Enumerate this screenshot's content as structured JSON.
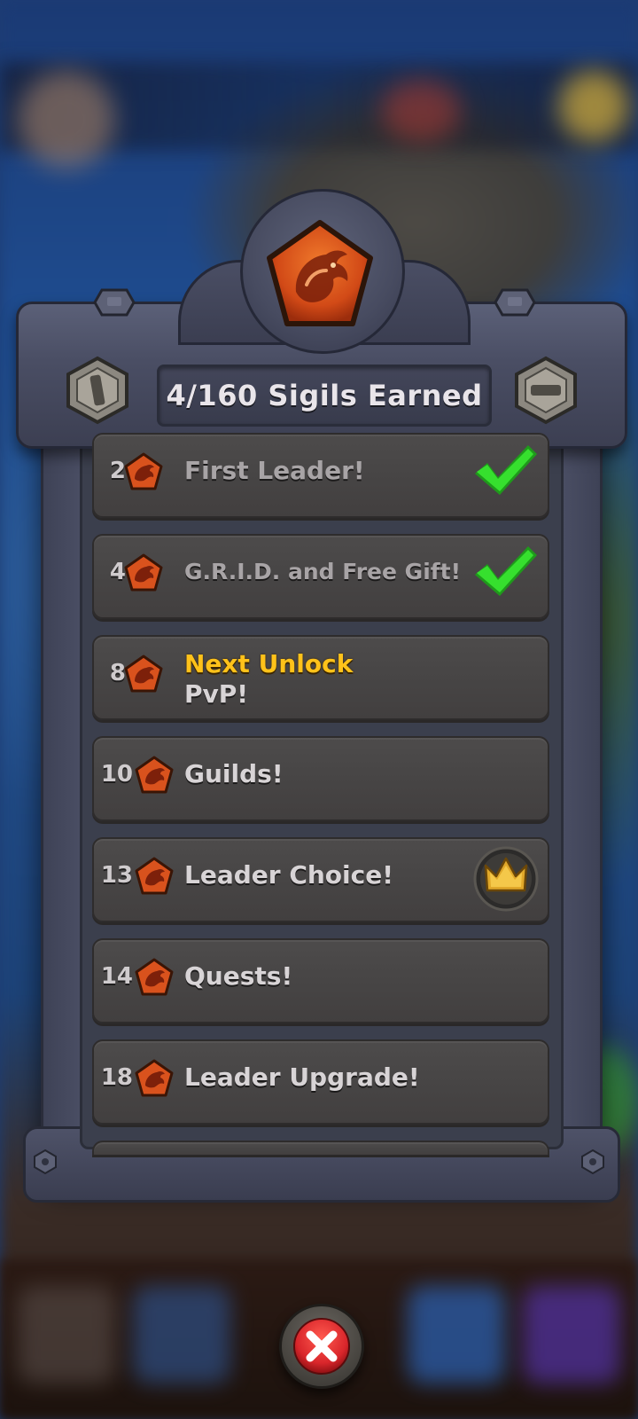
{
  "header": {
    "title": "4/160 Sigils Earned",
    "crest_icon": "dragon-sigil-icon"
  },
  "rows": [
    {
      "num": "2",
      "title": "First Leader!",
      "status": "completed",
      "badge": "check-icon"
    },
    {
      "num": "4",
      "title": "G.R.I.D. and Free Gift!",
      "status": "completed",
      "badge": "check-icon"
    },
    {
      "num": "8",
      "label": "Next Unlock",
      "title": "PvP!",
      "status": "next"
    },
    {
      "num": "10",
      "title": "Guilds!",
      "status": "locked"
    },
    {
      "num": "13",
      "title": "Leader Choice!",
      "status": "locked",
      "badge": "crown-icon"
    },
    {
      "num": "14",
      "title": "Quests!",
      "status": "locked"
    },
    {
      "num": "18",
      "title": "Leader Upgrade!",
      "status": "locked"
    }
  ],
  "close_button": {
    "icon": "close-icon"
  },
  "colors": {
    "accent_yellow": "#ffc21a",
    "check_green": "#2ed82a",
    "sigil_orange": "#e0551f",
    "close_red": "#d9262b"
  }
}
